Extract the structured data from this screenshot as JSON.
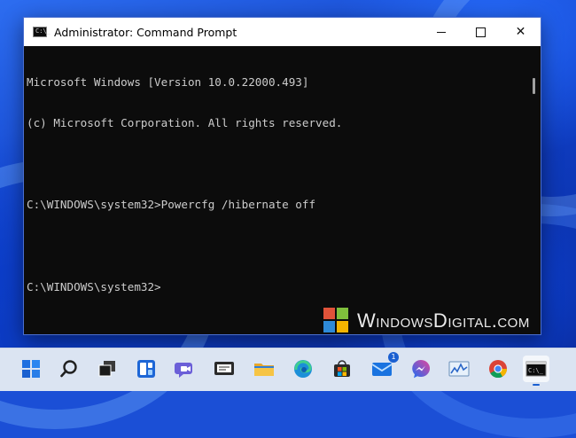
{
  "window": {
    "title": "Administrator: Command Prompt",
    "icon_label": "C:\\_",
    "controls": {
      "minimize": "minimize-icon",
      "maximize": "maximize-icon",
      "close": "✕"
    }
  },
  "console": {
    "lines": [
      "Microsoft Windows [Version 10.0.22000.493]",
      "(c) Microsoft Corporation. All rights reserved.",
      "",
      "C:\\WINDOWS\\system32>Powercfg /hibernate off",
      "",
      "C:\\WINDOWS\\system32>"
    ]
  },
  "watermark": {
    "text": "WindowsDigital.com"
  },
  "taskbar": {
    "items": [
      {
        "name": "start-icon"
      },
      {
        "name": "search-icon"
      },
      {
        "name": "task-view-icon"
      },
      {
        "name": "widgets-icon"
      },
      {
        "name": "teams-chat-icon"
      },
      {
        "name": "terminal-app-icon"
      },
      {
        "name": "file-explorer-icon"
      },
      {
        "name": "edge-icon"
      },
      {
        "name": "store-icon"
      },
      {
        "name": "mail-icon",
        "badge": "1"
      },
      {
        "name": "messenger-icon"
      },
      {
        "name": "performance-monitor-icon"
      },
      {
        "name": "chrome-icon"
      },
      {
        "name": "command-prompt-icon"
      }
    ]
  },
  "colors": {
    "console_bg": "#0c0c0c",
    "console_text": "#cccccc",
    "taskbar_bg": "#dbe4f2",
    "accent": "#1a5fd1"
  }
}
